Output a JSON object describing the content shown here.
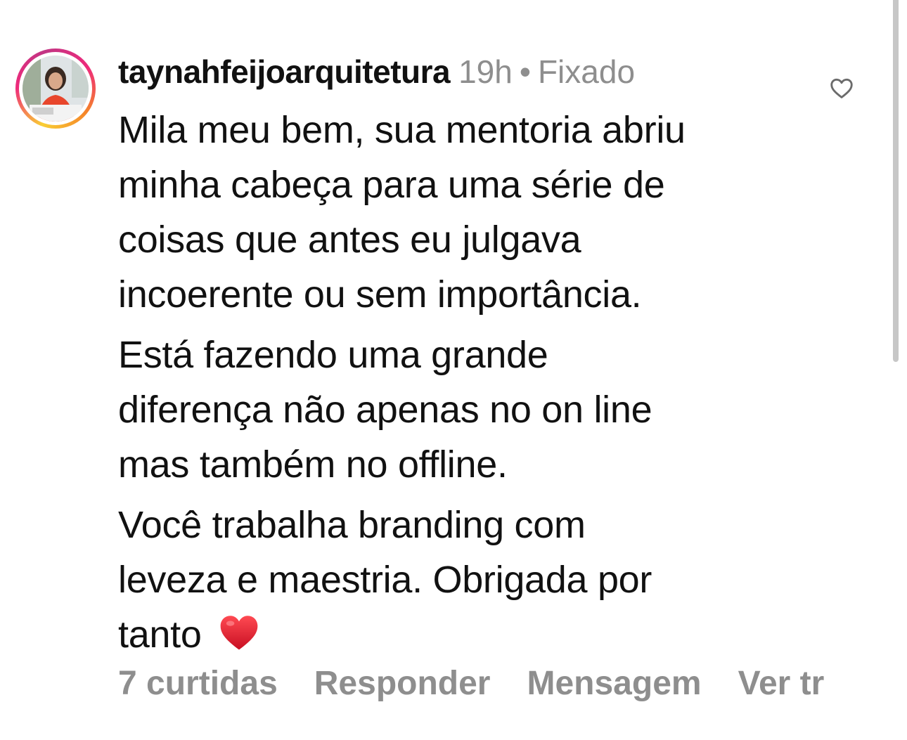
{
  "comment": {
    "username": "taynahfeijoarquitetura",
    "time": "19h",
    "separator": "•",
    "status": "Fixado",
    "paragraphs": [
      "Mila meu bem, sua mentoria abriu\nminha cabeça para uma série de\ncoisas que antes eu julgava\nincoerente ou sem importância.",
      "Está fazendo uma grande\ndiferença não apenas no on  line\nmas também no offline.",
      "Você trabalha branding com\nleveza e maestria. Obrigada por\ntanto"
    ],
    "emoji": "red-heart-emoji",
    "like_icon": "heart-outline-icon",
    "actions": {
      "likes": "7 curtidas",
      "reply": "Responder",
      "message": "Mensagem",
      "translate": "Ver tr"
    }
  },
  "colors": {
    "meta_gray": "#8e8e8e",
    "heart_red": "#e0142b",
    "ring_gradient": [
      "#f9ce34",
      "#ee2a7b",
      "#c13584",
      "#f58529"
    ]
  }
}
